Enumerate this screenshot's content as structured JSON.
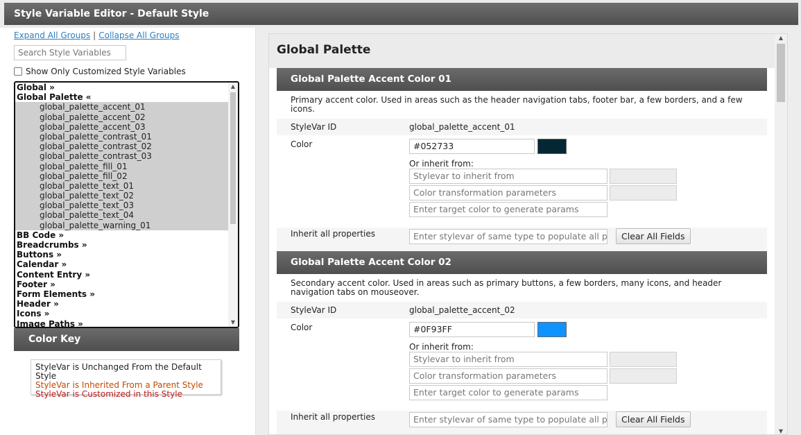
{
  "title": "Style Variable Editor - Default Style",
  "sidebar": {
    "expand_all": "Expand All Groups",
    "collapse_all": "Collapse All Groups",
    "separator": "|",
    "search_placeholder": "Search Style Variables",
    "show_customized_label": "Show Only Customized Style Variables",
    "groups": [
      {
        "label": "Global »",
        "type": "group"
      },
      {
        "label": "Global Palette «",
        "type": "group"
      },
      {
        "label": "global_palette_accent_01",
        "type": "child"
      },
      {
        "label": "global_palette_accent_02",
        "type": "child"
      },
      {
        "label": "global_palette_accent_03",
        "type": "child"
      },
      {
        "label": "global_palette_contrast_01",
        "type": "child"
      },
      {
        "label": "global_palette_contrast_02",
        "type": "child"
      },
      {
        "label": "global_palette_contrast_03",
        "type": "child"
      },
      {
        "label": "global_palette_fill_01",
        "type": "child"
      },
      {
        "label": "global_palette_fill_02",
        "type": "child"
      },
      {
        "label": "global_palette_text_01",
        "type": "child"
      },
      {
        "label": "global_palette_text_02",
        "type": "child"
      },
      {
        "label": "global_palette_text_03",
        "type": "child"
      },
      {
        "label": "global_palette_text_04",
        "type": "child"
      },
      {
        "label": "global_palette_warning_01",
        "type": "child"
      },
      {
        "label": "BB Code »",
        "type": "group"
      },
      {
        "label": "Breadcrumbs »",
        "type": "group"
      },
      {
        "label": "Buttons »",
        "type": "group"
      },
      {
        "label": "Calendar »",
        "type": "group"
      },
      {
        "label": "Content Entry »",
        "type": "group"
      },
      {
        "label": "Footer »",
        "type": "group"
      },
      {
        "label": "Form Elements »",
        "type": "group"
      },
      {
        "label": "Header »",
        "type": "group"
      },
      {
        "label": "Icons »",
        "type": "group"
      },
      {
        "label": "Image Paths »",
        "type": "group"
      }
    ],
    "color_key": {
      "title": "Color Key",
      "unchanged": "StyleVar is Unchanged From the Default Style",
      "inherited": "StyleVar is Inherited From a Parent Style",
      "customized": "StyleVar is Customized in this Style"
    }
  },
  "main": {
    "title": "Global Palette",
    "sections": [
      {
        "header": "Global Palette Accent Color 01",
        "description": "Primary accent color. Used in areas such as the header navigation tabs, footer bar, a few borders, and a few icons.",
        "stylevar_label": "StyleVar ID",
        "stylevar_id": "global_palette_accent_01",
        "color_label": "Color",
        "color_value": "#052733",
        "swatch_color": "#052733",
        "inherit_from_label": "Or inherit from:",
        "stylevar_placeholder": "Stylevar to inherit from",
        "transform_placeholder": "Color transformation parameters",
        "target_placeholder": "Enter target color to generate params",
        "inherit_all_label": "Inherit all properties",
        "inherit_all_placeholder": "Enter stylevar of same type to populate all properties",
        "clear_button": "Clear All Fields"
      },
      {
        "header": "Global Palette Accent Color 02",
        "description": "Secondary accent color. Used in areas such as primary buttons, a few borders, many icons, and header navigation tabs on mouseover.",
        "stylevar_label": "StyleVar ID",
        "stylevar_id": "global_palette_accent_02",
        "color_label": "Color",
        "color_value": "#0F93FF",
        "swatch_color": "#0F93FF",
        "inherit_from_label": "Or inherit from:",
        "stylevar_placeholder": "Stylevar to inherit from",
        "transform_placeholder": "Color transformation parameters",
        "target_placeholder": "Enter target color to generate params",
        "inherit_all_label": "Inherit all properties",
        "inherit_all_placeholder": "Enter stylevar of same type to populate all properties",
        "clear_button": "Clear All Fields"
      }
    ]
  }
}
